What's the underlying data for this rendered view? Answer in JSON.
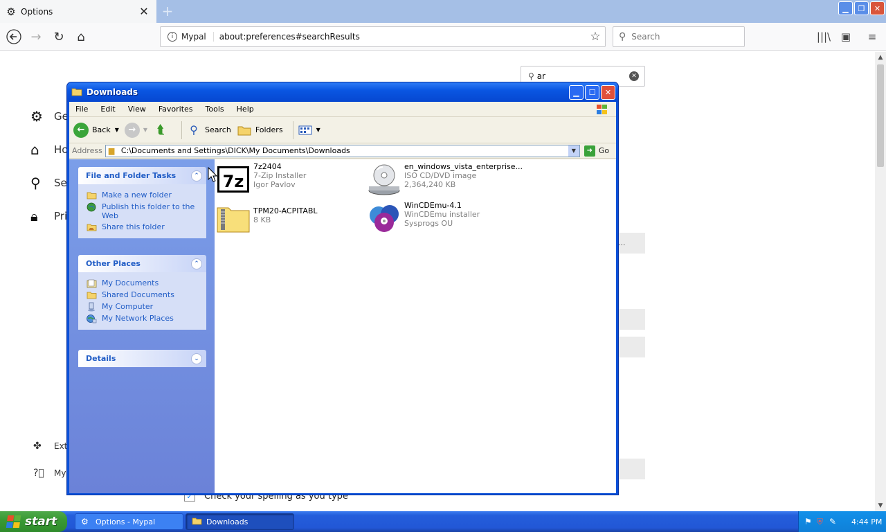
{
  "browser": {
    "tab_title": "Options",
    "tab_icon": "gear-icon",
    "site_label": "Mypal",
    "url": "about:preferences#searchResults",
    "search_placeholder": "Search"
  },
  "preferences": {
    "nav": [
      {
        "label": "Ge",
        "icon": "gear-icon"
      },
      {
        "label": "Ho",
        "icon": "home-icon"
      },
      {
        "label": "Se",
        "icon": "search-icon"
      },
      {
        "label": "Pri",
        "icon": "lock-icon"
      }
    ],
    "footer": [
      {
        "label": "Ext",
        "icon": "puzzle-icon"
      },
      {
        "label": "My",
        "icon": "help-icon"
      }
    ],
    "find_value": "ar",
    "spell_check_label": "Check your spelling as you type",
    "ellipsis_text": "..."
  },
  "explorer": {
    "title": "Downloads",
    "menu": [
      "File",
      "Edit",
      "View",
      "Favorites",
      "Tools",
      "Help"
    ],
    "toolbar": {
      "back": "Back",
      "search": "Search",
      "folders": "Folders"
    },
    "address": {
      "label": "Address",
      "path": "C:\\Documents and Settings\\DICK\\My Documents\\Downloads",
      "go": "Go"
    },
    "tasks": {
      "title": "File and Folder Tasks",
      "items": [
        {
          "label": "Make a new folder",
          "icon": "new-folder-icon"
        },
        {
          "label": "Publish this folder to the Web",
          "icon": "globe-icon"
        },
        {
          "label": "Share this folder",
          "icon": "share-folder-icon"
        }
      ]
    },
    "places": {
      "title": "Other Places",
      "items": [
        {
          "label": "My Documents",
          "icon": "documents-icon"
        },
        {
          "label": "Shared Documents",
          "icon": "folder-icon"
        },
        {
          "label": "My Computer",
          "icon": "computer-icon"
        },
        {
          "label": "My Network Places",
          "icon": "network-icon"
        }
      ]
    },
    "details": {
      "title": "Details"
    },
    "files": [
      {
        "name": "7z2404",
        "line2": "7-Zip Installer",
        "line3": "Igor Pavlov",
        "icon": "7zip-icon"
      },
      {
        "name": "en_windows_vista_enterprise...",
        "line2": "ISO CD/DVD image",
        "line3": "2,364,240 KB",
        "icon": "disc-image-icon"
      },
      {
        "name": "TPM20-ACPITABL",
        "line2": "8 KB",
        "line3": "",
        "icon": "zip-folder-icon"
      },
      {
        "name": "WinCDEmu-4.1",
        "line2": "WinCDEmu installer",
        "line3": "Sysprogs OU",
        "icon": "wincdemu-icon"
      }
    ]
  },
  "taskbar": {
    "start": "start",
    "tasks": [
      {
        "label": "Options - Mypal",
        "icon": "mypal-icon"
      },
      {
        "label": "Downloads",
        "icon": "folder-icon"
      }
    ],
    "clock": "4:44 PM"
  }
}
